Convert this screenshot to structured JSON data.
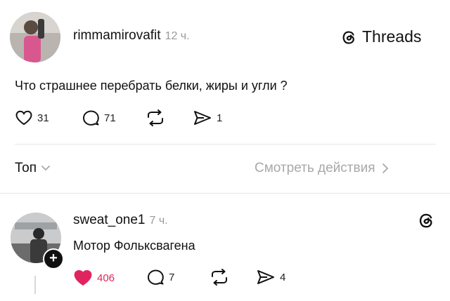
{
  "post": {
    "username": "rimmamirovafit",
    "time": "12 ч.",
    "brand": "Threads",
    "text": "Что страшнее перебрать белки, жиры и угли ?",
    "likes": "31",
    "replies": "71",
    "shares": "1"
  },
  "sort_bar": {
    "sort_label": "Топ",
    "activity_label": "Смотреть действия"
  },
  "reply": {
    "username": "sweat_one1",
    "time": "7 ч.",
    "text": "Мотор Фольксвагена",
    "likes": "406",
    "replies": "7",
    "shares": "4"
  },
  "colors": {
    "like_active": "#e0245e",
    "muted": "#9a9a9a"
  },
  "icons": [
    "heart-icon",
    "comment-icon",
    "repost-icon",
    "share-icon",
    "threads-logo-icon",
    "chevron-down-icon",
    "chevron-right-icon",
    "plus-icon"
  ]
}
